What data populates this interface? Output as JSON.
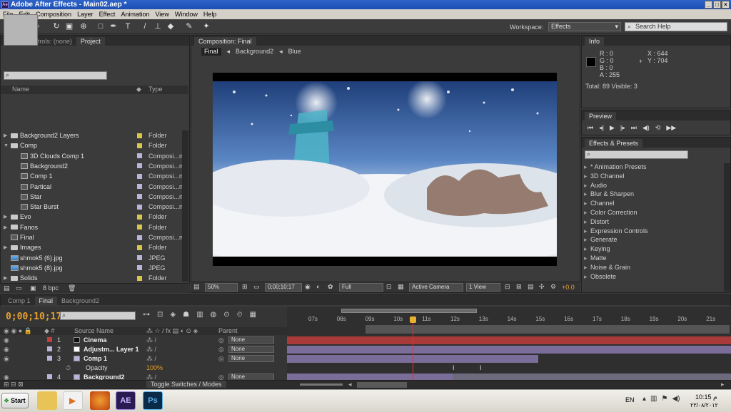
{
  "window": {
    "title": "Adobe After Effects - Main02.aep *",
    "app_icon_label": "Ae"
  },
  "menu": [
    "File",
    "Edit",
    "Composition",
    "Layer",
    "Effect",
    "Animation",
    "View",
    "Window",
    "Help"
  ],
  "toolbar": {
    "workspace_label": "Workspace:",
    "workspace_value": "Effects",
    "search_placeholder": "Search Help"
  },
  "left_panel": {
    "tabs": [
      "Effect Controls: (none)",
      "Project"
    ],
    "columns": {
      "name": "Name",
      "type": "Type"
    },
    "items": [
      {
        "name": "Background2 Layers",
        "type": "Folder",
        "kind": "folder",
        "indent": 0,
        "label_color": "#d8c84a"
      },
      {
        "name": "Comp",
        "type": "Folder",
        "kind": "folder",
        "indent": 0,
        "open": true,
        "label_color": "#d8c84a"
      },
      {
        "name": "3D Clouds Comp 1",
        "type": "Composi...n",
        "kind": "comp",
        "indent": 1,
        "label_color": "#b7b6d8"
      },
      {
        "name": "Background2",
        "type": "Composi...n",
        "kind": "comp",
        "indent": 1,
        "label_color": "#b7b6d8"
      },
      {
        "name": "Comp 1",
        "type": "Composi...n",
        "kind": "comp",
        "indent": 1,
        "label_color": "#b7b6d8"
      },
      {
        "name": "Partical",
        "type": "Composi...n",
        "kind": "comp",
        "indent": 1,
        "label_color": "#b7b6d8"
      },
      {
        "name": "Star",
        "type": "Composi...n",
        "kind": "comp",
        "indent": 1,
        "label_color": "#b7b6d8"
      },
      {
        "name": "Star Burst",
        "type": "Composi...n",
        "kind": "comp",
        "indent": 1,
        "label_color": "#b7b6d8"
      },
      {
        "name": "Evo",
        "type": "Folder",
        "kind": "folder",
        "indent": 0,
        "label_color": "#d8c84a"
      },
      {
        "name": "Fanos",
        "type": "Folder",
        "kind": "folder",
        "indent": 0,
        "label_color": "#d8c84a"
      },
      {
        "name": "Final",
        "type": "Composi...n",
        "kind": "comp",
        "indent": 0,
        "label_color": "#b7b6d8"
      },
      {
        "name": "Images",
        "type": "Folder",
        "kind": "folder",
        "indent": 0,
        "label_color": "#d8c84a"
      },
      {
        "name": "shmok5 (6).jpg",
        "type": "JPEG",
        "kind": "image",
        "indent": 0,
        "label_color": "#b7b6d8"
      },
      {
        "name": "shmok5 (8).jpg",
        "type": "JPEG",
        "kind": "image",
        "indent": 0,
        "label_color": "#b7b6d8"
      },
      {
        "name": "Solids",
        "type": "Folder",
        "kind": "folder",
        "indent": 0,
        "label_color": "#d8c84a"
      }
    ],
    "bpc": "8 bpc"
  },
  "composition": {
    "tab": "Composition: Final",
    "breadcrumbs": [
      "Final",
      "Background2",
      "Blue"
    ],
    "zoom": "50%",
    "timecode": "0;00;10;17",
    "resolution": "Full",
    "camera": "Active Camera",
    "view": "1 View",
    "exposure": "+0.0"
  },
  "info": {
    "tab": "Info",
    "R": "R : 0",
    "G": "G : 0",
    "B": "B : 0",
    "A": "A : 255",
    "X": "X : 644",
    "Y": "Y : 704",
    "total": "Total: 89  Visible: 3"
  },
  "preview": {
    "tab": "Preview"
  },
  "effects": {
    "tab": "Effects & Presets",
    "items": [
      "* Animation Presets",
      "3D Channel",
      "Audio",
      "Blur & Sharpen",
      "Channel",
      "Color Correction",
      "Distort",
      "Expression Controls",
      "Generate",
      "Keying",
      "Matte",
      "Noise & Grain",
      "Obsolete"
    ]
  },
  "timeline": {
    "tabs": [
      "Comp 1",
      "Final",
      "Background2"
    ],
    "timecode": "0;00;10;17",
    "col_source": "Source Name",
    "col_parent": "Parent",
    "ruler": [
      "07s",
      "08s",
      "09s",
      "10s",
      "11s",
      "12s",
      "13s",
      "14s",
      "15s",
      "16s",
      "17s",
      "18s",
      "19s",
      "20s",
      "21s"
    ],
    "layers": [
      {
        "num": "1",
        "name": "Cinema",
        "parent": "None",
        "swatch": "#111111",
        "bar_color": "#a83a3a"
      },
      {
        "num": "2",
        "name": "Adjustm... Layer 1",
        "parent": "None",
        "swatch": "#ffffff",
        "bar_color": "#7a6d9a"
      },
      {
        "num": "3",
        "name": "Comp 1",
        "parent": "None",
        "swatch": "#b7b6d8",
        "bar_color": "#7a6d9a"
      },
      {
        "num": "4",
        "name": "Background2",
        "parent": "None",
        "swatch": "#b7b6d8",
        "bar_color": "#7a6d9a"
      }
    ],
    "opacity_label": "Opacity",
    "opacity_value": "100%",
    "toggle_label": "Toggle Switches / Modes"
  },
  "taskbar": {
    "start": "Start",
    "lang": "EN",
    "time": "10:15 م",
    "date": "٢٣/٠٨/٢٠١٢",
    "ps_label": "Ps",
    "ae_label": "AE"
  }
}
